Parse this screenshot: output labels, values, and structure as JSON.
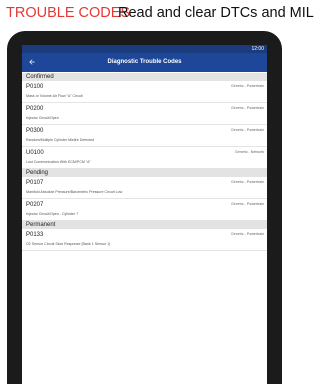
{
  "banner": {
    "highlight": "TROUBLE CODES",
    "tagline": "Read and clear DTCs and MIL"
  },
  "status_bar": {
    "time": "12:00"
  },
  "app_bar": {
    "title": "Diagnostic Trouble Codes",
    "back_icon": "arrow-back-icon"
  },
  "sections": [
    {
      "label": "Confirmed",
      "codes": [
        {
          "code": "P0100",
          "description": "Mass or Volume Air Flow \"A\" Circuit",
          "category": "Generic - Powertrain"
        },
        {
          "code": "P0200",
          "description": "Injector Circuit/Open",
          "category": "Generic - Powertrain"
        },
        {
          "code": "P0300",
          "description": "Random/Multiple Cylinder Misfire Detected",
          "category": "Generic - Powertrain"
        },
        {
          "code": "U0100",
          "description": "Lost Communication With ECM/PCM \"A\"",
          "category": "Generic - Network"
        }
      ]
    },
    {
      "label": "Pending",
      "codes": [
        {
          "code": "P0107",
          "description": "Manifold Absolute Pressure/Barometric Pressure Circuit Low",
          "category": "Generic - Powertrain"
        },
        {
          "code": "P0207",
          "description": "Injector Circuit/Open - Cylinder 7",
          "category": "Generic - Powertrain"
        }
      ]
    },
    {
      "label": "Permanent",
      "codes": [
        {
          "code": "P0133",
          "description": "O2 Sensor Circuit Slow Response (Bank 1 Sensor 1)",
          "category": "Generic - Powertrain"
        }
      ]
    }
  ],
  "colors": {
    "accent_red": "#e53935",
    "app_bar": "#1e4799",
    "status_bar": "#1a3c7c"
  }
}
